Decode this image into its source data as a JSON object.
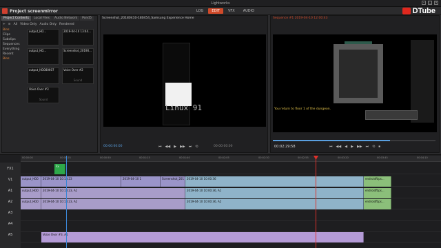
{
  "window": {
    "title": "Lightworks",
    "buttons": [
      "–",
      "□",
      "×"
    ]
  },
  "menubar": {
    "project_name": "Project screenmirror",
    "modes": [
      {
        "label": "LOG",
        "active": false
      },
      {
        "label": "EDIT",
        "active": true
      },
      {
        "label": "VFX",
        "active": false
      },
      {
        "label": "AUDIO",
        "active": false
      }
    ],
    "brand": "DTube"
  },
  "project_panel": {
    "tabs": [
      {
        "label": "Project Contents",
        "active": true
      },
      {
        "label": "Local Files",
        "active": false
      },
      {
        "label": "Audio Network",
        "active": false
      },
      {
        "label": "Pond5",
        "active": false
      }
    ],
    "tools": [
      "+",
      "≡",
      "All",
      "Video Only",
      "Audio Only",
      "Rendered"
    ],
    "bins": [
      {
        "label": "Bins",
        "highlight": true
      },
      {
        "label": "Clips",
        "highlight": false
      },
      {
        "label": "Subclips",
        "highlight": false
      },
      {
        "label": "Sequences",
        "highlight": false
      },
      {
        "label": "Everything",
        "highlight": false
      },
      {
        "label": "Recent",
        "highlight": false
      },
      {
        "label": "Bins",
        "highlight": true
      }
    ],
    "items": [
      {
        "title": "output_HD...",
        "sub": ""
      },
      {
        "title": "2019-04-10 13:44...",
        "sub": ""
      },
      {
        "title": "output_HD...",
        "sub": ""
      },
      {
        "title": "Screenshot_20190...",
        "sub": ""
      },
      {
        "title": "output_HD080607",
        "sub": ""
      },
      {
        "title": "Voice Over #2",
        "sub": "Sound"
      },
      {
        "title": "Voice Over #3",
        "sub": "Sound"
      }
    ]
  },
  "source_viewer": {
    "title": "Screenshot_20180410-180454_Samsung Experience Home",
    "screen_text": "Linux 91",
    "timecode_left": "00:00:00:00",
    "timecode_right": "00:00:00:00",
    "controls": [
      "⏮",
      "◀◀",
      "▶",
      "▶▶",
      "⏭",
      "⟲"
    ]
  },
  "record_viewer": {
    "title": "Sequence #1  2019-04-10 12:00:43",
    "game_text": "You return to floor 1 of the dungeon.",
    "timecode": "00:02:29:58",
    "controls": [
      "⏮",
      "◀◀",
      "◀",
      "▶",
      "▶▶",
      "⏭",
      "⟲",
      "⏹"
    ]
  },
  "timeline": {
    "ruler_ticks": [
      "00:00:00",
      "00:00:25",
      "00:00:50",
      "00:01:15",
      "00:01:40",
      "00:02:05",
      "00:02:30",
      "00:02:55",
      "00:03:20",
      "00:03:45",
      "00:04:10"
    ],
    "tracks": [
      "FX1",
      "V1",
      "A1",
      "A2",
      "A3",
      "A4",
      "A5"
    ],
    "fx_clip": "Fx",
    "v1_clips": [
      "output_HD0",
      "2019-04-10 10:13:23",
      "2019-04-10 1",
      "Screenshot_201",
      "2019-04-10 10:00:36",
      "endroidftips..."
    ],
    "a1_clips": [
      "output_HD0",
      "2019-04-10 10:13:23, A1",
      "2019-04-10 10:00:36, A1",
      "endroidftips..."
    ],
    "a2_clips": [
      "output_HD0",
      "2019-04-10 10:13:23, A2",
      "2019-04-10 10:00:36, A2",
      "endroidftips..."
    ],
    "a5_clip": "Voice Over #3, A1"
  }
}
